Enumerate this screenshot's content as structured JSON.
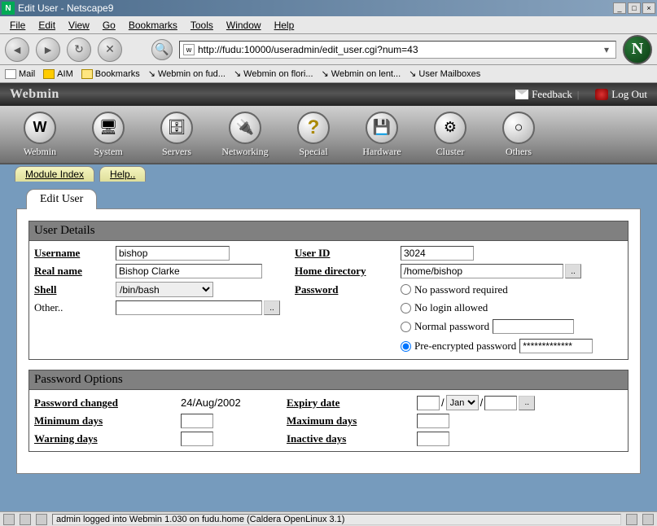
{
  "window": {
    "title": "Edit User - Netscape9"
  },
  "menubar": [
    "File",
    "Edit",
    "View",
    "Go",
    "Bookmarks",
    "Tools",
    "Window",
    "Help"
  ],
  "address_bar": "http://fudu:10000/useradmin/edit_user.cgi?num=43",
  "bookmarks": {
    "mail": "Mail",
    "aim": "AIM",
    "bookmarks": "Bookmarks",
    "items": [
      "Webmin on fud...",
      "Webmin on flori...",
      "Webmin on lent...",
      "User Mailboxes"
    ]
  },
  "webmin_header": {
    "brand": "Webmin",
    "feedback": "Feedback",
    "logout": "Log Out"
  },
  "nav": [
    {
      "label": "Webmin",
      "glyph": "W"
    },
    {
      "label": "System",
      "glyph": "🖥"
    },
    {
      "label": "Servers",
      "glyph": "🗄"
    },
    {
      "label": "Networking",
      "glyph": "🔌"
    },
    {
      "label": "Special",
      "glyph": "?"
    },
    {
      "label": "Hardware",
      "glyph": "💾"
    },
    {
      "label": "Cluster",
      "glyph": "⚙"
    },
    {
      "label": "Others",
      "glyph": "○"
    }
  ],
  "subtabs": {
    "module_index": "Module Index",
    "help": "Help.."
  },
  "page_tab": "Edit User",
  "sections": {
    "user_details": {
      "title": "User Details",
      "username_label": "Username",
      "username_value": "bishop",
      "userid_label": "User ID",
      "userid_value": "3024",
      "realname_label": "Real name",
      "realname_value": "Bishop Clarke",
      "home_label": "Home directory",
      "home_value": "/home/bishop",
      "shell_label": "Shell",
      "shell_value": "/bin/bash",
      "password_label": "Password",
      "other_label": "Other..",
      "pwd_options": {
        "none": "No password required",
        "nologin": "No login allowed",
        "normal": "Normal password",
        "encrypted": "Pre-encrypted password"
      },
      "encrypted_value": "*************"
    },
    "password_options": {
      "title": "Password Options",
      "changed_label": "Password changed",
      "changed_value": "24/Aug/2002",
      "expiry_label": "Expiry date",
      "expiry_month": "Jan",
      "min_label": "Minimum days",
      "max_label": "Maximum days",
      "warn_label": "Warning days",
      "inactive_label": "Inactive days"
    }
  },
  "statusbar": "admin logged into Webmin 1.030 on fudu.home (Caldera OpenLinux 3.1)"
}
